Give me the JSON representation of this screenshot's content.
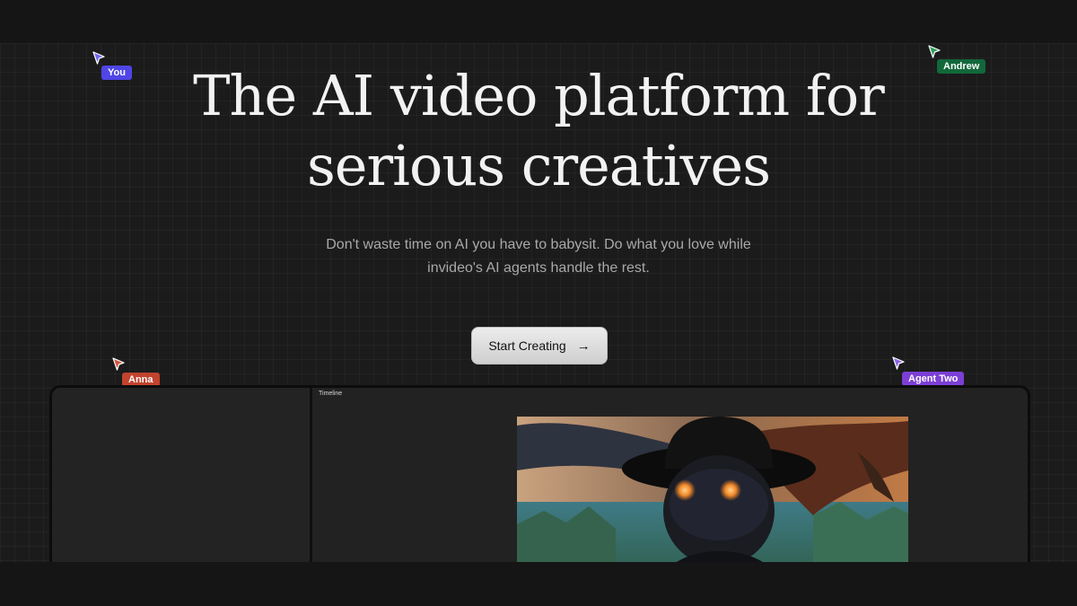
{
  "hero": {
    "headline_line1": "The AI video platform for",
    "headline_line2": "serious creatives",
    "subtitle_line1": "Don't waste time on AI you have to babysit. Do what you love while",
    "subtitle_line2": "invideo's AI agents handle the rest.",
    "cta_label": "Start Creating",
    "cta_icon": "arrow-right-icon"
  },
  "cursors": [
    {
      "label": "You",
      "color": "#4f46e5",
      "icon": "pointer-cursor-icon"
    },
    {
      "label": "Andrew",
      "color": "#12683a",
      "icon": "pointer-cursor-icon"
    },
    {
      "label": "Anna",
      "color": "#c2432e",
      "icon": "pointer-cursor-icon"
    },
    {
      "label": "Agent Two",
      "color": "#7c3fd6",
      "icon": "pointer-cursor-icon"
    }
  ],
  "editor": {
    "timeline_label": "Timeline",
    "preview_alt": "Video preview frame: masked figure in a black wide-brim hat with glowing orange eyes in front of a winged creature over a valley"
  },
  "colors": {
    "background": "#1b1b1b",
    "headline": "#f2f2f2",
    "subtitle": "#a9a9a9",
    "cta_bg": "#e0e0e0"
  }
}
